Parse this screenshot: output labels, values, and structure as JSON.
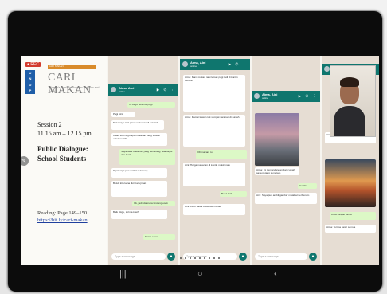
{
  "slide": {
    "rec_label": "● REC",
    "logo_letters": [
      "U",
      "N",
      "D",
      "P"
    ],
    "top_banner": "CARI MAKAN",
    "brand": "CARI MAKAN",
    "brand_subtitle": "Women's Conversations on Nutrition and Food",
    "session": "Session 2",
    "time": "11.15 am – 12.15 pm",
    "dialogue_line1": "Public Dialogue:",
    "dialogue_line2": "School Students",
    "reading": "Reading: Page 149–150",
    "link": "https://bit.ly/cari-makan"
  },
  "panel1": {
    "name": "Aima, Aini",
    "status": "online",
    "icons": "▶ ✆ ⋮",
    "composer": "Type a message",
    "messages": [
      {
        "dir": "out",
        "text": "Hi cikgu selamat pagi"
      },
      {
        "dir": "in",
        "text": "Pagi Aini"
      },
      {
        "dir": "in",
        "text": "Nak tanya sikit pasal makanan di sekolah"
      },
      {
        "dir": "in",
        "text": "Kalau ikut cikgu apa makanan yang sesuai untuk murid?"
      },
      {
        "dir": "out",
        "text": "Saya rasa makanan yang seimbang, ada sayur dan buah"
      },
      {
        "dir": "in",
        "text": "Tapi harga pun mahal sekarang"
      },
      {
        "dir": "in",
        "text": "Betul, kita kena fikir cara jimat"
      },
      {
        "dir": "out",
        "text": "Ok, jadi kita cuba bincang esok"
      },
      {
        "dir": "in",
        "text": "Baik cikgu, terima kasih"
      },
      {
        "dir": "out",
        "text": "Sama-sama"
      }
    ]
  },
  "panel2": {
    "name": "Aima, Aini",
    "status": "online",
    "icons": "▶ ✆ ⋮",
    "composer": "Type a message",
    "messages": [
      {
        "dir": "in",
        "text": "Aima: Kami makan nasi lemak pagi tadi di kantin sekolah"
      },
      {
        "dir": "in",
        "text": "Aima: Ramai kawan tak sempat sarapan di rumah"
      },
      {
        "dir": "out",
        "text": "Oh macam tu"
      },
      {
        "dir": "in",
        "text": "Aini: Harga makanan di kantin makin naik"
      },
      {
        "dir": "out",
        "text": "Betul ke?"
      },
      {
        "dir": "in",
        "text": "Aini: Kami bawa bekal dari rumah"
      }
    ]
  },
  "panel3": {
    "name": "Aima, Aini",
    "status": "online",
    "icons": "▶ ✆ ⋮",
    "composer": "Type a message",
    "messages": [
      {
        "dir": "in",
        "text": "Aima: Ini pemandangan dari rumah saya petang semalam"
      },
      {
        "dir": "out",
        "text": "Cantik!"
      },
      {
        "dir": "in",
        "text": "Aini: Saya pun ambil gambar matahari terbenam"
      }
    ]
  },
  "panel4": {
    "name": "Aima, Aini",
    "status": "online",
    "messages": [
      {
        "dir": "in",
        "text": "Aini: Ini gambar dari bumbung rumah"
      },
      {
        "dir": "out",
        "text": "Wow sangat cantik"
      },
      {
        "dir": "in",
        "text": "Aima: Terima kasih semua"
      }
    ]
  },
  "nav": {
    "recent": "|||",
    "home": "○",
    "back": "‹"
  }
}
